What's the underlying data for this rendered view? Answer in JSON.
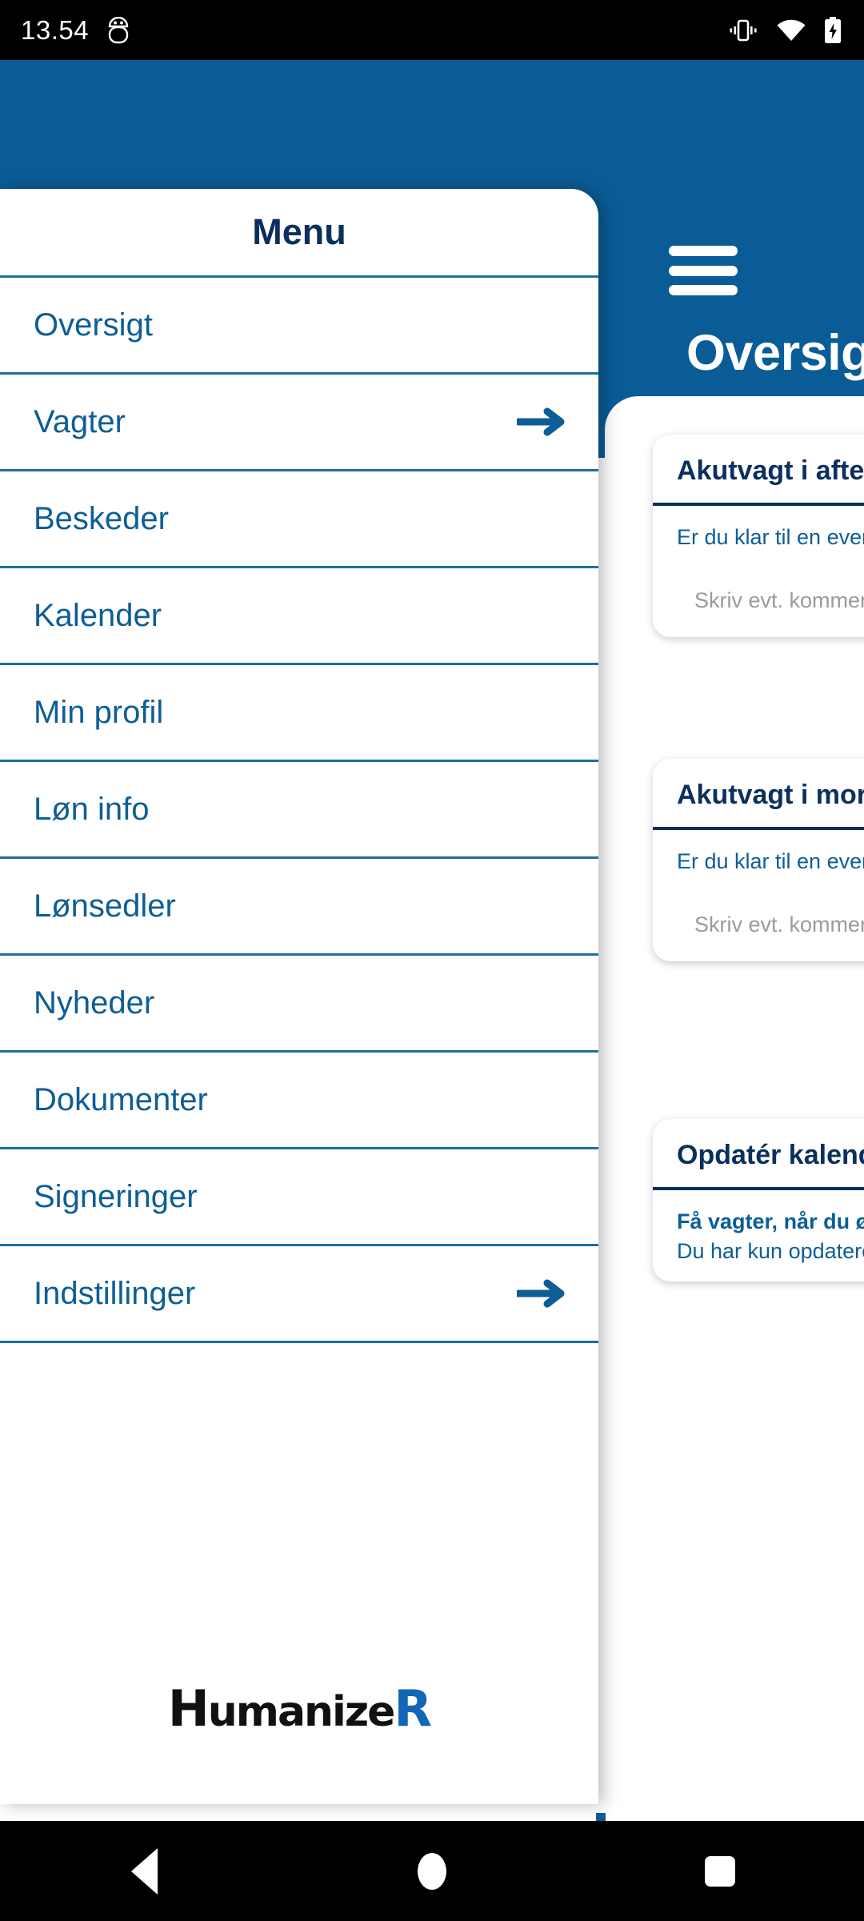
{
  "status_bar": {
    "clock": "13.54",
    "icons_left": [
      "android-debug-icon"
    ],
    "icons_right": [
      "vibrate-icon",
      "wifi-icon",
      "battery-charging-icon"
    ]
  },
  "header": {
    "menu_icon": "hamburger-icon",
    "title": "Oversigt",
    "background_color": "#0a5c96"
  },
  "drawer": {
    "title": "Menu",
    "items": [
      {
        "label": "Oversigt",
        "arrow": false
      },
      {
        "label": "Vagter",
        "arrow": true
      },
      {
        "label": "Beskeder",
        "arrow": false
      },
      {
        "label": "Kalender",
        "arrow": false
      },
      {
        "label": "Min profil",
        "arrow": false
      },
      {
        "label": "Løn info",
        "arrow": false
      },
      {
        "label": "Lønsedler",
        "arrow": false
      },
      {
        "label": "Nyheder",
        "arrow": false
      },
      {
        "label": "Dokumenter",
        "arrow": false
      },
      {
        "label": "Signeringer",
        "arrow": false
      },
      {
        "label": "Indstillinger",
        "arrow": true
      }
    ],
    "logo": {
      "part1": "H",
      "part2": "umanize",
      "part3": "R"
    }
  },
  "cards": [
    {
      "title": "Akutvagt i aften",
      "question": "Er du klar til en eventuel akutvagt i aften?",
      "placeholder": "Skriv evt. kommentar her"
    },
    {
      "title": "Akutvagt i morgen",
      "question": "Er du klar til en eventuel akutvagt i morgen?",
      "placeholder": "Skriv evt. kommentar her"
    },
    {
      "title": "Opdatér kalender",
      "line1": "Få vagter, når du ønsker dem",
      "line2": "Du har kun opdateret din kalender"
    }
  ],
  "nav_bar": {
    "back": "back-triangle-icon",
    "home": "home-circle-icon",
    "recents": "recents-square-icon"
  },
  "colors": {
    "brand_blue": "#0a5c96",
    "link_blue": "#0d5e96",
    "navy": "#0b2f5e",
    "divider": "#1d6ea3",
    "placeholder_gray": "#9b9b9b"
  }
}
